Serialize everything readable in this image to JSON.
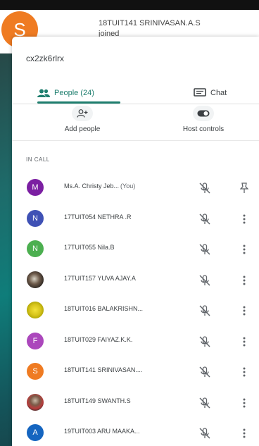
{
  "notification": {
    "avatar_letter": "S",
    "avatar_color": "#ef7b22",
    "line1": "18TUIT141 SRINIVASAN.A.S",
    "line2": "joined"
  },
  "panel": {
    "meeting_code": "cx2zk6rlrx",
    "tabs": [
      {
        "label": "People (24)",
        "icon": "people-icon",
        "active": true
      },
      {
        "label": "Chat",
        "icon": "chat-icon",
        "active": false
      }
    ],
    "actions": [
      {
        "label": "Add people",
        "icon": "add-person-icon"
      },
      {
        "label": "Host controls",
        "icon": "toggle-icon"
      }
    ],
    "section_title": "IN CALL",
    "accent_color": "#1e7e6e"
  },
  "participants": [
    {
      "name": "Ms.A. Christy Jeb...",
      "you": "(You)",
      "avatar": "M",
      "color": "#7b1fa2",
      "trailing": "pin-icon"
    },
    {
      "name": "17TUIT054 NETHRA .R",
      "avatar": "N",
      "color": "#3f51b5",
      "trailing": "more-vert-icon"
    },
    {
      "name": "17TUIT055 Nila.B",
      "avatar": "N",
      "color": "#4caf50",
      "trailing": "more-vert-icon"
    },
    {
      "name": "17TUIT157 YUVA AJAY.A",
      "avatar": "",
      "color": "photo-owl",
      "trailing": "more-vert-icon"
    },
    {
      "name": "18TUIT016 BALAKRISHN...",
      "avatar": "",
      "color": "photo-flower",
      "trailing": "more-vert-icon"
    },
    {
      "name": "18TUIT029 FAIYAZ.K.K.",
      "avatar": "F",
      "color": "#ab47bc",
      "trailing": "more-vert-icon"
    },
    {
      "name": "18TUIT141 SRINIVASAN....",
      "avatar": "S",
      "color": "#ef7b22",
      "trailing": "more-vert-icon"
    },
    {
      "name": "18TUIT149 SWANTH.S",
      "avatar": "",
      "color": "photo-people",
      "trailing": "more-vert-icon"
    },
    {
      "name": "19TUIT003 ARU MAAKA...",
      "avatar": "A",
      "color": "#1565c0",
      "trailing": "more-vert-icon"
    }
  ]
}
